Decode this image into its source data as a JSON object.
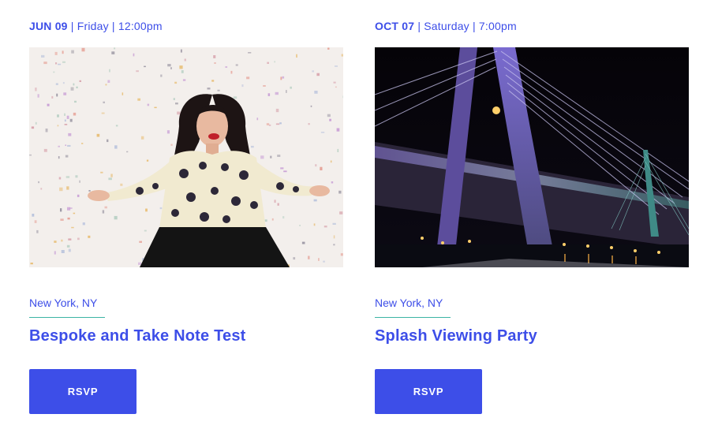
{
  "events": [
    {
      "date": "JUN 09",
      "day": "Friday",
      "time": "12:00pm",
      "image": "woman-with-confetti-photo",
      "location": "New York, NY",
      "title": "Bespoke and Take Note Test",
      "rsvp_label": "RSVP"
    },
    {
      "date": "OCT 07",
      "day": "Saturday",
      "time": "7:00pm",
      "image": "bridge-at-night-photo",
      "location": "New York, NY",
      "title": "Splash Viewing Party",
      "rsvp_label": "RSVP"
    }
  ],
  "separator": "|",
  "colors": {
    "accent": "#3d4ee8",
    "divider": "#3bb3a4",
    "button_text": "#ffffff"
  }
}
